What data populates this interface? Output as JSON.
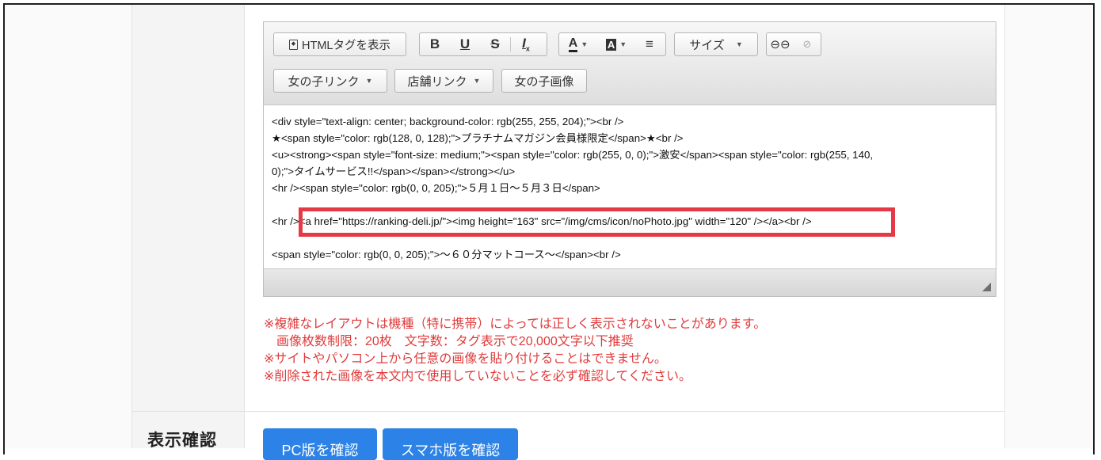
{
  "toolbar": {
    "html_tag_label": "HTMLタグを表示",
    "bold": "B",
    "underline": "U",
    "strike": "S",
    "clear_format": "I",
    "font_color": "A",
    "bg_color": "A",
    "size_label": "サイズ",
    "girl_link": "女の子リンク",
    "shop_link": "店舗リンク",
    "girl_image": "女の子画像"
  },
  "content": {
    "lines": [
      "<div style=\"text-align: center; background-color: rgb(255, 255, 204);\"><br />",
      "★<span style=\"color: rgb(128, 0, 128);\">プラチナムマガジン会員様限定</span>★<br />",
      "<u><strong><span style=\"font-size: medium;\"><span style=\"color: rgb(255, 0, 0);\">激安</span><span style=\"color: rgb(255, 140,",
      "0);\">タイムサービス!!</span></span></strong></u>",
      "<hr /><span style=\"color: rgb(0, 0, 205);\">５月１日〜５月３日</span>",
      "<hr /><a href=\"https://ranking-deli.jp/\"><img height=\"163\" src=\"/img/cms/icon/noPhoto.jpg\" width=\"120\" /></a><br />",
      "<span style=\"color: rgb(0, 0, 205);\">〜６０分マットコース〜</span><br />"
    ]
  },
  "notes": [
    "※複雑なレイアウトは機種（特に携帯）によっては正しく表示されないことがあります。",
    "　画像枚数制限：20枚　文字数：タグ表示で20,000文字以下推奨",
    "※サイトやパソコン上から任意の画像を貼り付けることはできません。",
    "※削除された画像を本文内で使用していないことを必ず確認してください。"
  ],
  "display_check": {
    "label": "表示確認",
    "pc_button": "PC版を確認",
    "sp_button": "スマホ版を確認"
  },
  "colors": {
    "note_red": "#e03b3b",
    "highlight_red": "#e53a45",
    "button_blue": "#2c82e6"
  }
}
